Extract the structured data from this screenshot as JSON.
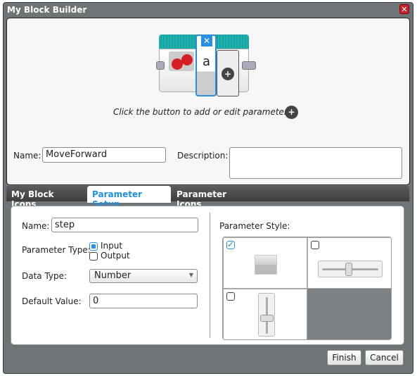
{
  "window": {
    "title": "My Block Builder",
    "close_icon": "close-icon"
  },
  "builder": {
    "hint": "Click the button to add or edit parameters.",
    "param_letter": "a",
    "name_label": "Name:",
    "name_value": "MoveForward",
    "description_label": "Description:",
    "description_value": ""
  },
  "tabs": [
    {
      "label": "My Block Icons"
    },
    {
      "label": "Parameter Setup",
      "active": true
    },
    {
      "label": "Parameter Icons"
    }
  ],
  "param": {
    "name_label": "Name:",
    "name_value": "step",
    "type_label": "Parameter Type:",
    "type_options": [
      {
        "label": "Input",
        "checked": true
      },
      {
        "label": "Output",
        "checked": false
      }
    ],
    "data_type_label": "Data Type:",
    "data_type_value": "Number",
    "default_label": "Default Value:",
    "default_value": "0",
    "style_label": "Parameter Style:",
    "styles": [
      {
        "name": "plug",
        "checked": true
      },
      {
        "name": "horizontal-slider",
        "checked": false
      },
      {
        "name": "vertical-slider",
        "checked": false
      }
    ]
  },
  "footer": {
    "finish": "Finish",
    "cancel": "Cancel"
  },
  "colors": {
    "accent": "#1e90e0",
    "block_header": "#1fb3b0",
    "chrome": "#6e7375"
  }
}
